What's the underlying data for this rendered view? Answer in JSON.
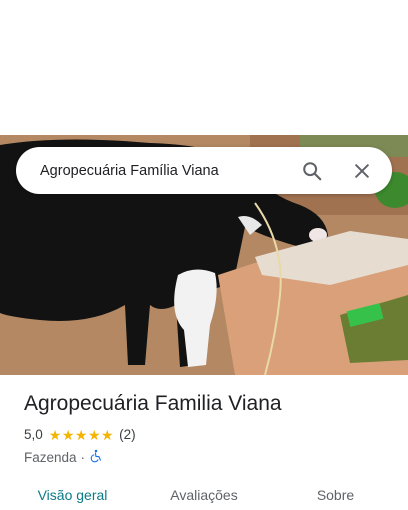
{
  "search": {
    "query": "Agropecuária Família Viana",
    "icons": {
      "search": "search-icon",
      "close": "close-icon"
    }
  },
  "hero": {
    "description_icon": "photo"
  },
  "place": {
    "title": "Agropecuária Familia Viana",
    "rating": "5,0",
    "stars": 5,
    "review_count": "(2)",
    "category": "Fazenda",
    "separator": "·",
    "accessibility_icon": "wheelchair-icon"
  },
  "tabs": [
    {
      "label": "Visão geral",
      "active": true
    },
    {
      "label": "Avaliações",
      "active": false
    },
    {
      "label": "Sobre",
      "active": false
    }
  ],
  "colors": {
    "accent": "#0b7a87",
    "star": "#f4b400",
    "accessibility": "#1a73e8"
  }
}
